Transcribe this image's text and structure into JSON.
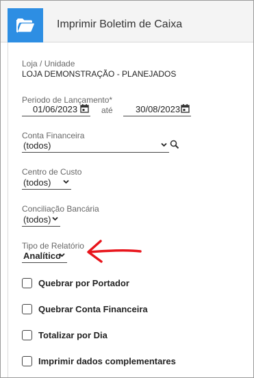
{
  "header": {
    "title": "Imprimir Boletim de Caixa",
    "icon": "folder-open-icon",
    "accent_color": "#2d8ee3"
  },
  "form": {
    "loja": {
      "label": "Loja / Unidade",
      "value": "LOJA DEMONSTRAÇÃO - PLANEJADOS"
    },
    "periodo": {
      "label": "Periodo de Lançamento*",
      "start": "01/06/2023",
      "separator": "até",
      "end": "30/08/2023"
    },
    "conta_financeira": {
      "label": "Conta Financeira",
      "value": "(todos)"
    },
    "centro_custo": {
      "label": "Centro de Custo",
      "value": "(todos)"
    },
    "conciliacao": {
      "label": "Conciliação Bancária",
      "value": "(todos)"
    },
    "tipo_relatorio": {
      "label": "Tipo de Relatório",
      "value": "Analítico"
    },
    "checkboxes": [
      {
        "label": "Quebrar por Portador",
        "checked": false
      },
      {
        "label": "Quebrar Conta Financeira",
        "checked": false
      },
      {
        "label": "Totalizar por Dia",
        "checked": false
      },
      {
        "label": "Imprimir dados complementares",
        "checked": false
      }
    ]
  },
  "annotation": {
    "color": "#e8141b",
    "points_to": "tipo_relatorio"
  }
}
